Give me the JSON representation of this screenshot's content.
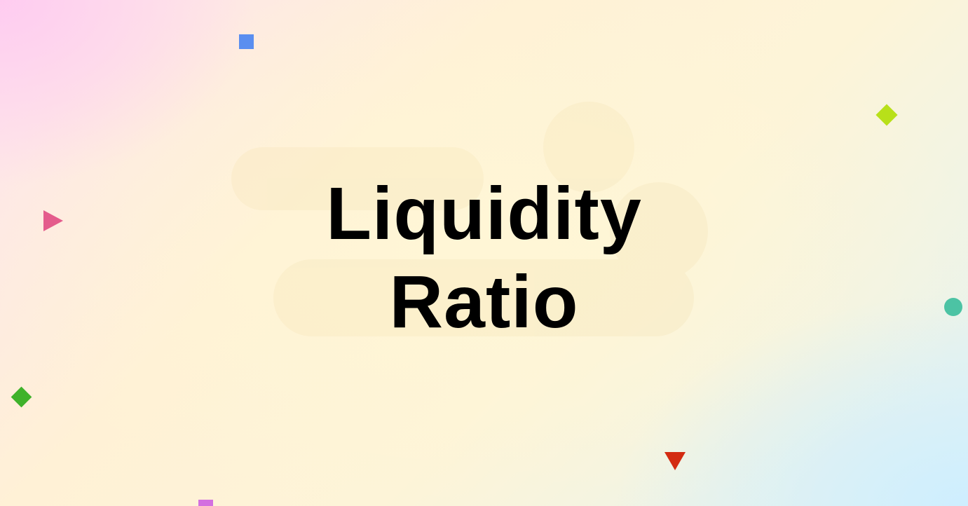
{
  "title": {
    "line1": "Liquidity",
    "line2": "Ratio"
  },
  "decorations": [
    {
      "shape": "square",
      "color": "#5a8ef0"
    },
    {
      "shape": "diamond",
      "color": "#b8e019"
    },
    {
      "shape": "triangle",
      "color": "#e45c8c"
    },
    {
      "shape": "circle",
      "color": "#4cc3a4"
    },
    {
      "shape": "diamond",
      "color": "#3fb22a"
    },
    {
      "shape": "triangle",
      "color": "#d32b11"
    },
    {
      "shape": "square",
      "color": "#d36fe0"
    }
  ],
  "colors": {
    "text": "#000000",
    "background_top_left": "#fde3ef",
    "background_center": "#fff1d6",
    "background_bottom_right": "#e3f3f3"
  }
}
